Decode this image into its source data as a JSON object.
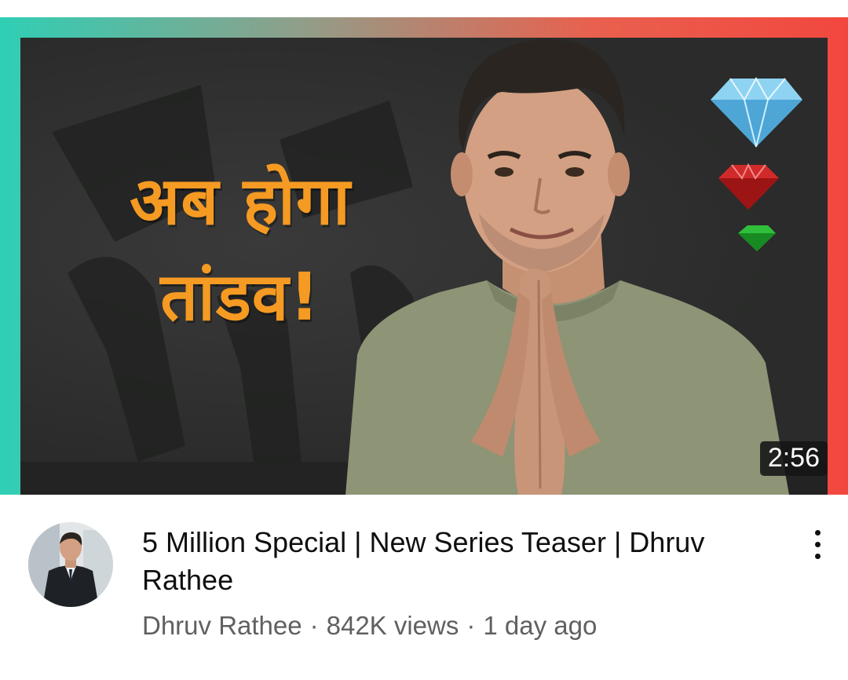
{
  "video": {
    "thumbnail": {
      "headline_line1": "अब होगा",
      "headline_line2": "तांडव!",
      "duration": "2:56",
      "gems": [
        "diamond-icon",
        "ruby-icon",
        "emerald-icon"
      ]
    },
    "title": "5 Million Special | New Series Teaser | Dhruv Rathee",
    "channel": "Dhruv Rathee",
    "separator": "·",
    "views": "842K views",
    "age": "1 day ago",
    "menu_icon": "more-vert-icon"
  },
  "colors": {
    "headline": "#f59a22",
    "border_left": "#2fcfb5",
    "border_right": "#f2473f",
    "meta_text": "#606060",
    "title_text": "#0f0f0f"
  }
}
